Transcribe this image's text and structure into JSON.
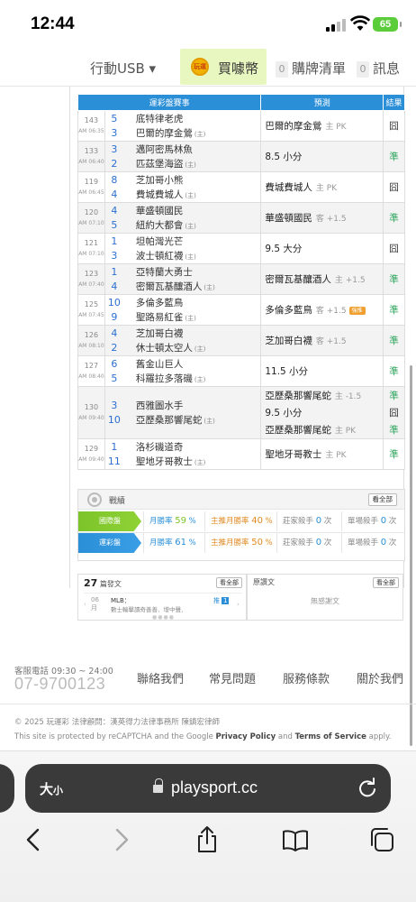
{
  "status": {
    "time": "12:44",
    "battery": "65"
  },
  "nav": {
    "usb": "行動USB ▾",
    "coin": "玩運",
    "buy": "買噱幣",
    "cart_count": "0",
    "cart": "購牌清單",
    "msg_count": "0",
    "msg": "訊息"
  },
  "table": {
    "headers": [
      "運彩盤賽事",
      "預測",
      "結果"
    ],
    "rows": [
      {
        "id": "143",
        "time": "AM 06:35",
        "teams": [
          {
            "n": "5",
            "name": "底特律老虎",
            "home": ""
          },
          {
            "n": "3",
            "name": "巴爾的摩金鶯",
            "home": "(主)"
          }
        ],
        "preds": [
          {
            "text": "巴爾的摩金鶯",
            "line": "主 PK",
            "tag": ""
          }
        ],
        "results": [
          "囧"
        ],
        "shade": "a"
      },
      {
        "id": "133",
        "time": "AM 06:40",
        "teams": [
          {
            "n": "3",
            "name": "邁阿密馬林魚",
            "home": ""
          },
          {
            "n": "2",
            "name": "匹茲堡海盜",
            "home": "(主)"
          }
        ],
        "preds": [
          {
            "text": "8.5 小分",
            "line": "",
            "tag": ""
          }
        ],
        "results": [
          "準"
        ],
        "shade": "b"
      },
      {
        "id": "119",
        "time": "AM 06:45",
        "teams": [
          {
            "n": "8",
            "name": "芝加哥小熊",
            "home": ""
          },
          {
            "n": "4",
            "name": "費城費城人",
            "home": "(主)"
          }
        ],
        "preds": [
          {
            "text": "費城費城人",
            "line": "主 PK",
            "tag": ""
          }
        ],
        "results": [
          "囧"
        ],
        "shade": "a"
      },
      {
        "id": "120",
        "time": "AM 07:10",
        "teams": [
          {
            "n": "4",
            "name": "華盛頓國民",
            "home": ""
          },
          {
            "n": "5",
            "name": "紐約大都會",
            "home": "(主)"
          }
        ],
        "preds": [
          {
            "text": "華盛頓國民",
            "line": "客 +1.5",
            "tag": ""
          }
        ],
        "results": [
          "準"
        ],
        "shade": "b"
      },
      {
        "id": "121",
        "time": "AM 07:10",
        "teams": [
          {
            "n": "1",
            "name": "坦帕灣光芒",
            "home": ""
          },
          {
            "n": "3",
            "name": "波士頓紅襪",
            "home": "(主)"
          }
        ],
        "preds": [
          {
            "text": "9.5 大分",
            "line": "",
            "tag": ""
          }
        ],
        "results": [
          "囧"
        ],
        "shade": "a"
      },
      {
        "id": "123",
        "time": "AM 07:40",
        "teams": [
          {
            "n": "1",
            "name": "亞特蘭大勇士",
            "home": ""
          },
          {
            "n": "4",
            "name": "密爾瓦基釀酒人",
            "home": "(主)"
          }
        ],
        "preds": [
          {
            "text": "密爾瓦基釀酒人",
            "line": "主 +1.5",
            "tag": ""
          }
        ],
        "results": [
          "準"
        ],
        "shade": "b"
      },
      {
        "id": "125",
        "time": "AM 07:45",
        "teams": [
          {
            "n": "10",
            "name": "多倫多藍鳥",
            "home": ""
          },
          {
            "n": "9",
            "name": "聖路易紅雀",
            "home": "(主)"
          }
        ],
        "preds": [
          {
            "text": "多倫多藍鳥",
            "line": "客 +1.5",
            "tag": "強推"
          }
        ],
        "results": [
          "準"
        ],
        "shade": "a"
      },
      {
        "id": "126",
        "time": "AM 08:10",
        "teams": [
          {
            "n": "4",
            "name": "芝加哥白襪",
            "home": ""
          },
          {
            "n": "2",
            "name": "休士頓太空人",
            "home": "(主)"
          }
        ],
        "preds": [
          {
            "text": "芝加哥白襪",
            "line": "客 +1.5",
            "tag": ""
          }
        ],
        "results": [
          "準"
        ],
        "shade": "b"
      },
      {
        "id": "127",
        "time": "AM 08:40",
        "teams": [
          {
            "n": "6",
            "name": "舊金山巨人",
            "home": ""
          },
          {
            "n": "5",
            "name": "科羅拉多落磯",
            "home": "(主)"
          }
        ],
        "preds": [
          {
            "text": "11.5 小分",
            "line": "",
            "tag": ""
          }
        ],
        "results": [
          "準"
        ],
        "shade": "a"
      },
      {
        "id": "130",
        "time": "AM 09:40",
        "teams": [
          {
            "n": "3",
            "name": "西雅圖水手",
            "home": ""
          },
          {
            "n": "10",
            "name": "亞歷桑那響尾蛇",
            "home": "(主)"
          }
        ],
        "preds": [
          {
            "text": "亞歷桑那響尾蛇",
            "line": "主 -1.5",
            "tag": ""
          },
          {
            "text": "9.5 小分",
            "line": "",
            "tag": ""
          },
          {
            "text": "亞歷桑那響尾蛇",
            "line": "主 PK",
            "tag": ""
          }
        ],
        "results": [
          "準",
          "囧",
          "準"
        ],
        "shade": "b"
      },
      {
        "id": "129",
        "time": "AM 09:40",
        "teams": [
          {
            "n": "1",
            "name": "洛杉磯道奇",
            "home": ""
          },
          {
            "n": "11",
            "name": "聖地牙哥教士",
            "home": "(主)"
          }
        ],
        "preds": [
          {
            "text": "聖地牙哥教士",
            "line": "主 PK",
            "tag": ""
          }
        ],
        "results": [
          "準"
        ],
        "shade": "a"
      }
    ]
  },
  "record": {
    "title": "戰績",
    "all": "看全部",
    "rows": [
      {
        "label": "國際盤",
        "c1l": "月勝率",
        "c1v": "59",
        "c2l": "主推月勝率",
        "c2v": "40",
        "c3l": "莊家殺手",
        "c3v": "0",
        "c4l": "單場殺手",
        "c4v": "0"
      },
      {
        "label": "運彩盤",
        "c1l": "月勝率",
        "c1v": "61",
        "c2l": "主推月勝率",
        "c2v": "50",
        "c3l": "莊家殺手",
        "c3v": "0",
        "c4l": "單場殺手",
        "c4v": "0"
      }
    ],
    "pct": "%",
    "times": "次"
  },
  "posts": {
    "count": "27",
    "label": "篇發文",
    "all": "看全部",
    "day": "06",
    "month": "月",
    "title": "MLB：",
    "sub": "數士輸擊讀奇善善．增中聲．",
    "push": "推",
    "push_n": "1"
  },
  "replies": {
    "label": "原讚文",
    "all": "看全部",
    "empty": "無感謝文"
  },
  "footer": {
    "svc_label": "客服電話 09:30 ~ 24:00",
    "svc_tel": "07-9700123",
    "links": [
      "聯絡我們",
      "常見問題",
      "服務條款",
      "關於我們"
    ],
    "copyright": "© 2025  玩運彩  法律顧問：漢英得力法律事務所 陳鎮宏律師",
    "protect_pre": "This site is protected by reCAPTCHA and the Google ",
    "privacy": "Privacy Policy",
    "and": " and ",
    "terms": "Terms of Service",
    "protect_post": " apply."
  },
  "browser": {
    "aa": "大",
    "aa_small": "小",
    "url": "playsport.cc"
  }
}
